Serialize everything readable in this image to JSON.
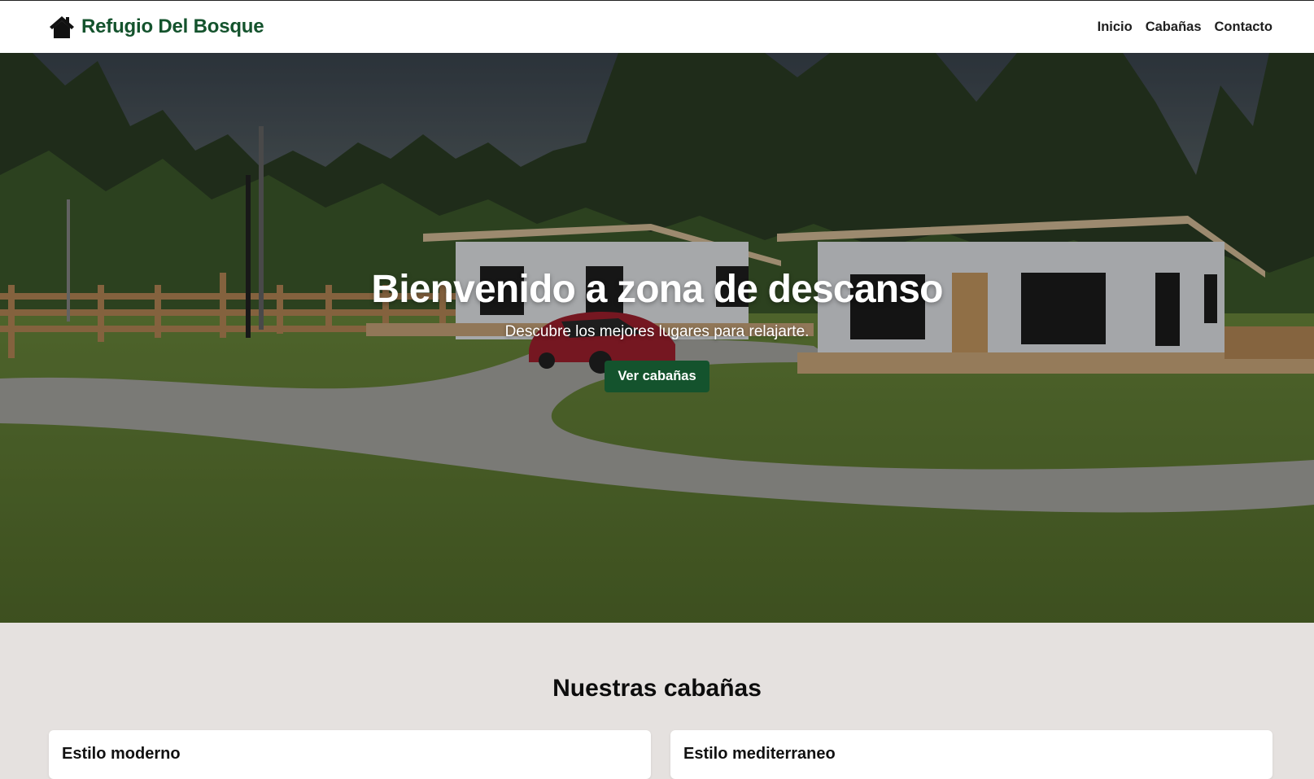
{
  "header": {
    "brand_icon": "house-icon",
    "brand_title": "Refugio Del Bosque",
    "brand_color": "#14532d",
    "nav": [
      {
        "label": "Inicio"
      },
      {
        "label": "Cabañas"
      },
      {
        "label": "Contacto"
      }
    ]
  },
  "hero": {
    "title": "Bienvenido a zona de descanso",
    "subtitle": "Descubre los mejores lugares para relajarte.",
    "button_label": "Ver cabañas",
    "button_color": "#14532d"
  },
  "cabins": {
    "title": "Nuestras cabañas",
    "background": "#e5e1df",
    "items": [
      {
        "title": "Estilo moderno"
      },
      {
        "title": "Estilo mediterraneo"
      }
    ]
  }
}
